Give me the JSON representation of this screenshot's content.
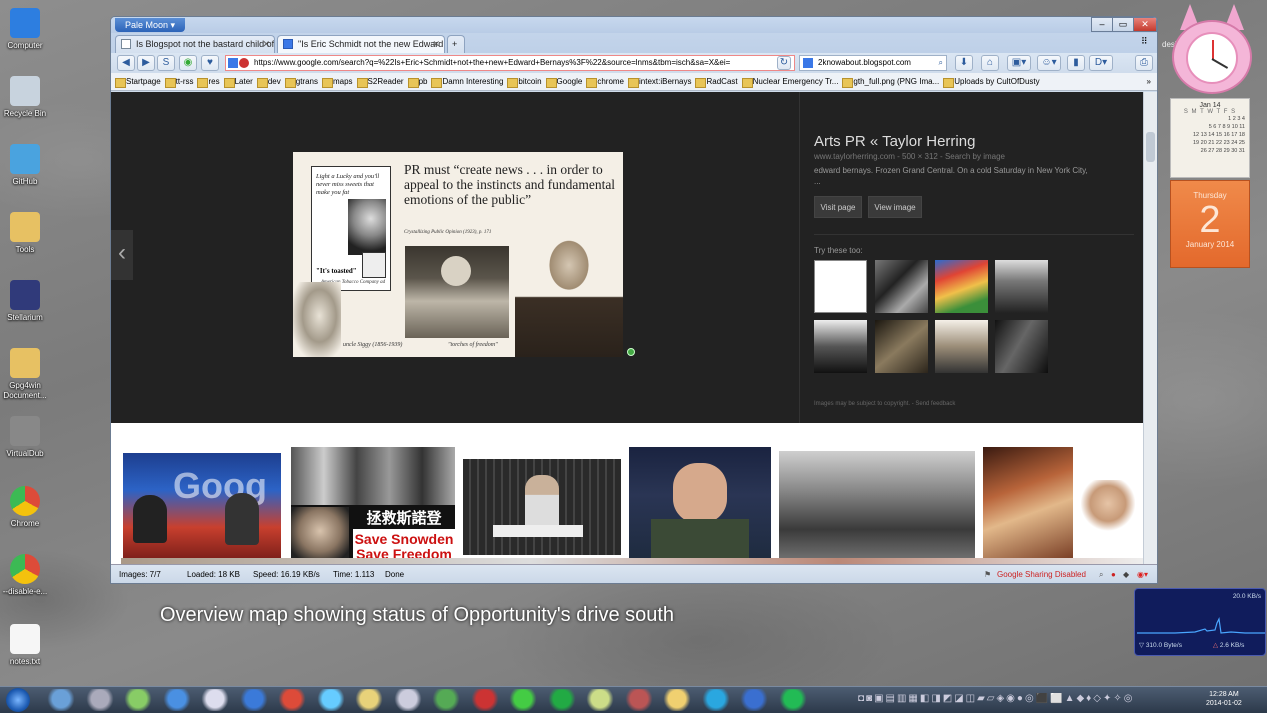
{
  "desktop": {
    "icons": [
      {
        "label": "Computer",
        "name": "computer-icon",
        "color": "#2d7ee0"
      },
      {
        "label": "Recycle Bin",
        "name": "recycle-bin-icon",
        "color": "#c8d3de"
      },
      {
        "label": "GitHub",
        "name": "github-icon",
        "color": "#4aa3df"
      },
      {
        "label": "Tools",
        "name": "folder-icon",
        "color": "#e7c163"
      },
      {
        "label": "Stellarium",
        "name": "stellarium-icon",
        "color": "#303a7a"
      },
      {
        "label": "Gpg4win Document...",
        "name": "folder-icon",
        "color": "#e7c163"
      },
      {
        "label": "VirtualDub",
        "name": "virtualdub-icon",
        "color": "#888888"
      },
      {
        "label": "Chrome",
        "name": "chrome-icon",
        "color": "#dd4b39"
      },
      {
        "label": "--disable-e...",
        "name": "chrome-icon",
        "color": "#dd4b39"
      },
      {
        "label": "notes.txt",
        "name": "text-file-icon",
        "color": "#f6f6f6"
      }
    ],
    "caption": "Overview map showing status of Opportunity's drive south",
    "desk_label": "desk"
  },
  "browser": {
    "app_button": "Pale Moon",
    "tabs": [
      {
        "title": "Is Blogspot not the bastard child of C...",
        "active": false
      },
      {
        "title": "\"Is Eric Schmidt not the new Edward ...",
        "active": true
      }
    ],
    "url": "https://www.google.com/search?q=%22Is+Eric+Schmidt+not+the+new+Edward+Bernays%3F%22&source=lnms&tbm=isch&sa=X&ei=",
    "search_value": "2knowabout.blogspot.com",
    "bookmarks": [
      "Startpage",
      "tt-rss",
      "res",
      "Later",
      "dev",
      "gtrans",
      "maps",
      "S2Reader",
      "pb",
      "Damn Interesting",
      "bitcoin",
      "Google",
      "chrome",
      "intext:iBernays",
      "RadCast",
      "Nuclear Emergency Tr...",
      "gth_full.png (PNG Ima...",
      "Uploads by CultOfDusty"
    ],
    "more_glyph": "»",
    "status": {
      "images": "Images: 7/7",
      "loaded": "Loaded: 18 KB",
      "speed": "Speed: 16.19 KB/s",
      "time": "Time: 1.113",
      "done": "Done",
      "sharing": "Google Sharing Disabled"
    }
  },
  "viewer": {
    "title": "Arts PR « Taylor Herring",
    "meta": "www.taylorherring.com - 500 × 312 - Search by image",
    "description": "edward bernays. Frozen Grand Central. On a cold Saturday in New York City,",
    "ellipsis": "...",
    "visit_button": "Visit page",
    "view_button": "View image",
    "try_these": "Try these too:",
    "copyright": "Images may be subject to copyright. - Send feedback",
    "close": "✕",
    "prev": "‹",
    "next": "›",
    "preview": {
      "quote": "PR must “create news . . . in order to appeal to the instincts and fundamental emotions of the public”",
      "cite": "Crystallizing Public Opinion (1923), p. 171",
      "ad_top": "Light a Lucky and you'll never miss sweets that make you fat",
      "ad_toasted": "\"It's toasted\"",
      "ad_company": "American Tobacco Company ad",
      "uncle": "uncle Siggy (1856-1939)",
      "torches": "\"torches of freedom\""
    }
  },
  "results_text": {
    "snowden1": "Save Snowden",
    "snowden2": "Save Freedom",
    "chinese": "拯救斯諾登",
    "google_sign": "Goog"
  },
  "gadgets": {
    "calendar_month": "Jan 14",
    "calendar_days": "S M T W T F S",
    "cal_rows": [
      "1 2 3 4",
      "5 6 7 8 9 10 11",
      "12 13 14 15 16 17 18",
      "19 20 21 22 23 24 25",
      "26 27 28 29 30 31"
    ],
    "day_name": "Thursday",
    "day_num": "2",
    "month_year": "January 2014",
    "net_top": "20.0 KB/s",
    "net_down": "310.0 Byte/s",
    "net_up": "2.6 KB/s"
  },
  "taskbar": {
    "time": "12:28 AM",
    "date": "2014-01-02"
  }
}
